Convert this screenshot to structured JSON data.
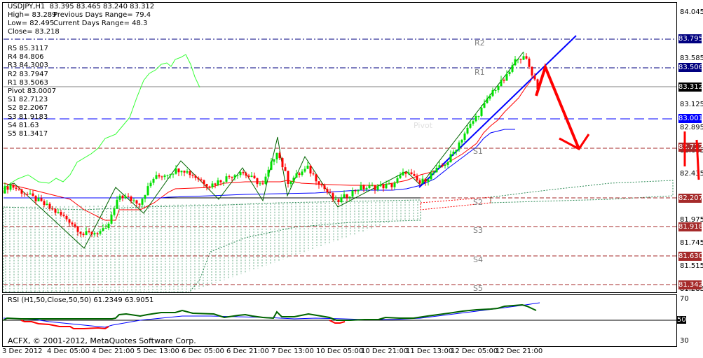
{
  "header": {
    "line1": "USDJPY,H1  83.395 83.465 83.240 83.312",
    "high": "High= 83.289",
    "prev_range": "Previous Days Range= 79.4",
    "low": "Low= 82.495",
    "cur_range": "Current Days Range= 48.3",
    "close": "Close= 83.218"
  },
  "pivots": [
    "R5 85.3117",
    "R4 84.806",
    "R3 84.3003",
    "R2 83.7947",
    "R1 83.5063",
    "Pivot 83.0007",
    "S1 82.7123",
    "S2 82.2067",
    "S3 81.9183",
    "S4 81.63",
    "S5 81.3417"
  ],
  "pivot_chart_labels": [
    "R2",
    "R1",
    "Pivot",
    "S1",
    "S2",
    "S3",
    "S4",
    "S5"
  ],
  "price_axis": [
    "84.045",
    "83.585",
    "83.125",
    "82.895",
    "82.665",
    "82.435",
    "81.975",
    "81.745",
    "81.515",
    "81.285"
  ],
  "level_tags": [
    {
      "text": "83.795",
      "color": "#000080"
    },
    {
      "text": "83.506",
      "color": "#000080"
    },
    {
      "text": "83.312",
      "color": "#000000"
    },
    {
      "text": "83.001",
      "color": "#0000ff"
    },
    {
      "text": "82.712",
      "color": "#a52a2a"
    },
    {
      "text": "82.207",
      "color": "#a52a2a"
    },
    {
      "text": "81.918",
      "color": "#a52a2a"
    },
    {
      "text": "81.630",
      "color": "#a52a2a"
    },
    {
      "text": "81.342",
      "color": "#a52a2a"
    }
  ],
  "rsi": {
    "label": "RSI (H1,50,Close,50,50) 61.2349 63.9051",
    "axis": [
      "70",
      "50",
      "30"
    ]
  },
  "copyright": "ACFX, © 2001-2012, MetaQuotes Software Corp.",
  "time_axis": [
    "3 Dec 2012",
    "4 Dec 05:00",
    "4 Dec 21:00",
    "5 Dec 13:00",
    "6 Dec 05:00",
    "6 Dec 21:00",
    "7 Dec 13:00",
    "10 Dec 05:00",
    "10 Dec 21:00",
    "11 Dec 13:00",
    "12 Dec 05:00",
    "12 Dec 21:00"
  ],
  "chart_data": {
    "type": "candlestick",
    "symbol": "USDJPY",
    "timeframe": "H1",
    "ylim": [
      81.285,
      84.045
    ],
    "close_anchors": [
      [
        0,
        82.28
      ],
      [
        3,
        82.33
      ],
      [
        12,
        82.19
      ],
      [
        24,
        81.98
      ],
      [
        29,
        81.84
      ],
      [
        37,
        81.88
      ],
      [
        42,
        82.23
      ],
      [
        49,
        82.16
      ],
      [
        54,
        82.4
      ],
      [
        64,
        82.5
      ],
      [
        74,
        82.33
      ],
      [
        85,
        82.47
      ],
      [
        93,
        82.33
      ],
      [
        98,
        82.68
      ],
      [
        102,
        82.37
      ],
      [
        109,
        82.5
      ],
      [
        119,
        82.16
      ],
      [
        127,
        82.3
      ],
      [
        139,
        82.33
      ],
      [
        144,
        82.47
      ],
      [
        149,
        82.35
      ],
      [
        159,
        82.57
      ],
      [
        165,
        82.85
      ],
      [
        172,
        83.13
      ],
      [
        175,
        83.27
      ],
      [
        180,
        83.41
      ],
      [
        184,
        83.62
      ],
      [
        187,
        83.58
      ],
      [
        190,
        83.38
      ],
      [
        191,
        83.31
      ]
    ],
    "colors": {
      "up": "#00e000",
      "down": "#ff0000"
    }
  }
}
